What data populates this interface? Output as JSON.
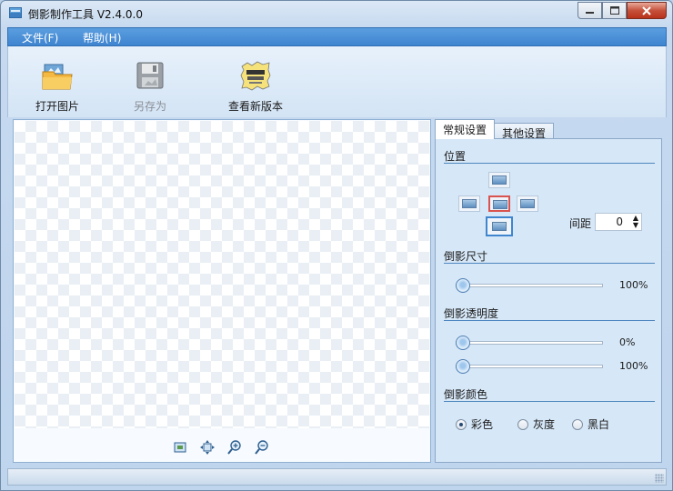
{
  "window": {
    "title": "倒影制作工具 V2.4.0.0"
  },
  "menu": [
    {
      "label": "文件(F)"
    },
    {
      "label": "帮助(H)"
    }
  ],
  "toolbar": {
    "open_label": "打开图片",
    "saveas_label": "另存为",
    "update_label": "查看新版本"
  },
  "canvas_tools": [
    "fit-to-window-icon",
    "actual-size-icon",
    "zoom-in-icon",
    "zoom-out-icon"
  ],
  "tabs": [
    {
      "label": "常规设置",
      "active": true
    },
    {
      "label": "其他设置",
      "active": false
    }
  ],
  "settings": {
    "position": {
      "section_label": "位置",
      "selected": "center",
      "spacing_label": "间距",
      "spacing_value": "0"
    },
    "size": {
      "section_label": "倒影尺寸",
      "value_label": "100%",
      "value": 100
    },
    "opacity": {
      "section_label": "倒影透明度",
      "start_label": "0%",
      "start_value": 0,
      "end_label": "100%",
      "end_value": 100
    },
    "color": {
      "section_label": "倒影颜色",
      "options": [
        {
          "label": "彩色",
          "checked": true
        },
        {
          "label": "灰度",
          "checked": false
        },
        {
          "label": "黑白",
          "checked": false
        }
      ]
    }
  },
  "colors": {
    "menubar": "#3e84cf",
    "accent": "#4e86bf",
    "selection": "#d9534f"
  }
}
